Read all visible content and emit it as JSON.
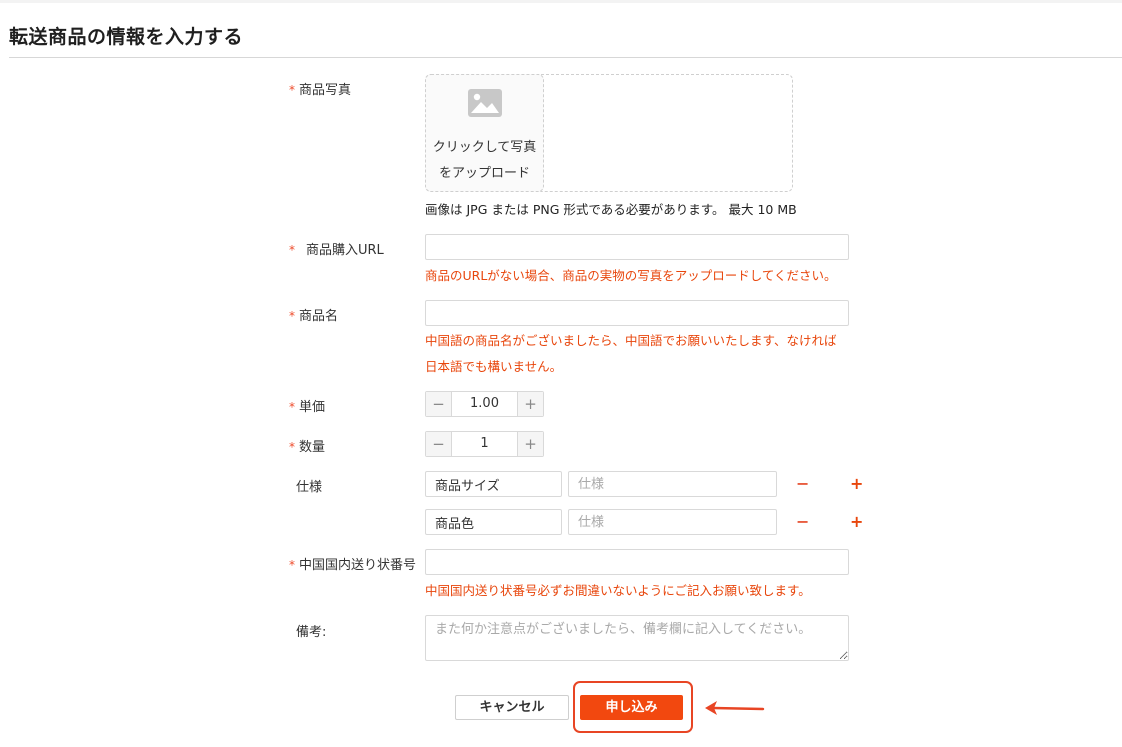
{
  "page": {
    "title": "転送商品の情報を入力する"
  },
  "form": {
    "photo": {
      "label": "商品写真",
      "upload_text": "クリックして写真をアップロード",
      "note": "画像は JPG または PNG 形式である必要があります。 最大 10 MB",
      "icon": "image-icon"
    },
    "url": {
      "label": "商品購入URL",
      "value": "",
      "warning": "商品のURLがない場合、商品の実物の写真をアップロードしてください。"
    },
    "name": {
      "label": "商品名",
      "value": "",
      "warning_line1": "中国語の商品名がございましたら、中国語でお願いいたします、なければ",
      "warning_line2": "日本語でも構いません。"
    },
    "price": {
      "label": "単価",
      "value": "1.00",
      "minus": "−",
      "plus": "+"
    },
    "quantity": {
      "label": "数量",
      "value": "1",
      "minus": "−",
      "plus": "+"
    },
    "specs": {
      "label": "仕様",
      "rows": [
        {
          "name": "商品サイズ",
          "value_placeholder": "仕様",
          "remove": "−",
          "add": "+"
        },
        {
          "name": "商品色",
          "value_placeholder": "仕様",
          "remove": "−",
          "add": "+"
        }
      ]
    },
    "tracking": {
      "label": "中国国内送り状番号",
      "value": "",
      "warning": "中国国内送り状番号必ずお間違いないようにご記入お願い致します。"
    },
    "remarks": {
      "label": "備考:",
      "placeholder": "また何か注意点がございましたら、備考欄に記入してください。"
    },
    "required_mark": "*"
  },
  "actions": {
    "cancel_label": "キャンセル",
    "submit_label": "申し込み"
  },
  "colors": {
    "accent": "#f2480f",
    "warning_text": "#e8460c",
    "highlight_border": "#e84524"
  }
}
